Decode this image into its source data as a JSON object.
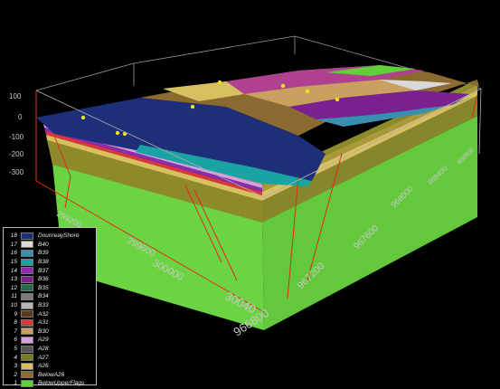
{
  "depth_ticks": [
    "100",
    "0",
    "-100",
    "-200",
    "-300"
  ],
  "easting_ticks": [
    "299200",
    "299600",
    "300000",
    "30040"
  ],
  "northing_ticks": [
    "966800",
    "967200",
    "967600",
    "968000",
    "968400",
    "968800"
  ],
  "legend": {
    "items": [
      {
        "num": "18",
        "name": "DounreayShore",
        "color": "#1e2f7a"
      },
      {
        "num": "17",
        "name": "B40",
        "color": "#d9d9d9"
      },
      {
        "num": "16",
        "name": "B39",
        "color": "#3a8fb0"
      },
      {
        "num": "15",
        "name": "B38",
        "color": "#1aa3a3"
      },
      {
        "num": "14",
        "name": "B37",
        "color": "#8a2bb0"
      },
      {
        "num": "13",
        "name": "B36",
        "color": "#7a2090"
      },
      {
        "num": "12",
        "name": "B35",
        "color": "#1f6a4a"
      },
      {
        "num": "11",
        "name": "B34",
        "color": "#7a7a7a"
      },
      {
        "num": "10",
        "name": "B33",
        "color": "#b7b7b7"
      },
      {
        "num": "9",
        "name": "A32",
        "color": "#5a3a1a"
      },
      {
        "num": "8",
        "name": "A31",
        "color": "#d8383a"
      },
      {
        "num": "7",
        "name": "B30",
        "color": "#c9a060"
      },
      {
        "num": "6",
        "name": "A29",
        "color": "#d6a0d8"
      },
      {
        "num": "5",
        "name": "A28",
        "color": "#555555"
      },
      {
        "num": "4",
        "name": "A27",
        "color": "#7a7a20"
      },
      {
        "num": "3",
        "name": "A26",
        "color": "#d8c060"
      },
      {
        "num": "2",
        "name": "BelowA26",
        "color": "#8a6a30"
      },
      {
        "num": "1",
        "name": "BelowUpperFlags",
        "color": "#5ed038"
      }
    ]
  }
}
